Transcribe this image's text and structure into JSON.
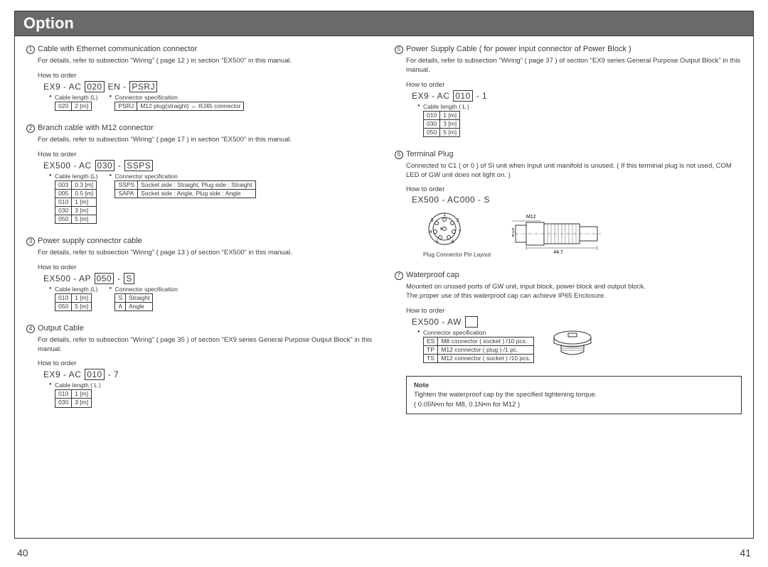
{
  "title": "Option",
  "page_left": "40",
  "page_right": "41",
  "left": {
    "s1": {
      "num": "1",
      "title": "Cable with Ethernet communication connector",
      "body": "For details, refer to subsection \"Wiring\" ( page 12 ) in section \"EX500\" in this manual.",
      "howto": "How to order",
      "pn_prefix": "EX9 - AC",
      "pn_box1": "020",
      "pn_mid": "EN -",
      "pn_box2": "PSRJ",
      "len_label": "Cable length (L)",
      "len_rows": [
        [
          "020",
          "2 [m]"
        ]
      ],
      "conn_label": "Connector specification",
      "conn_rows": [
        [
          "PSRJ",
          "M12 plug(straight) ↔ RJ45 connector"
        ]
      ]
    },
    "s2": {
      "num": "2",
      "title": "Branch cable with M12 connector",
      "body": "For details, refer to subsection \"Wiring\" ( page 17 ) in section \"EX500\" in this manual.",
      "howto": "How to order",
      "pn_prefix": "EX500 - AC",
      "pn_box1": "030",
      "pn_mid": "-",
      "pn_box2": "SSPS",
      "len_label": "Cable length (L)",
      "len_rows": [
        [
          "003",
          "0.3 [m]"
        ],
        [
          "005",
          "0.5 [m]"
        ],
        [
          "010",
          "1 [m]"
        ],
        [
          "030",
          "3 [m]"
        ],
        [
          "050",
          "5 [m]"
        ]
      ],
      "conn_label": "Connector specification",
      "conn_rows": [
        [
          "SSPS",
          "Socket side : Straight, Plug side : Straight"
        ],
        [
          "SAPA",
          "Socket side : Angle, Plug side : Angle"
        ]
      ]
    },
    "s3": {
      "num": "3",
      "title": "Power supply connector cable",
      "body": "For details, refer to subsection \"Wiring\" ( page 13 ) of section \"EX500\" in this manual.",
      "howto": "How to order",
      "pn_prefix": "EX500 - AP",
      "pn_box1": "050",
      "pn_mid": "-",
      "pn_box2": "S",
      "len_label": "Cable length (L)",
      "len_rows": [
        [
          "010",
          "1 [m]"
        ],
        [
          "050",
          "5 [m]"
        ]
      ],
      "conn_label": "Connector specification",
      "conn_rows": [
        [
          "S",
          "Straight"
        ],
        [
          "A",
          "Angle"
        ]
      ]
    },
    "s4": {
      "num": "4",
      "title": "Output Cable",
      "body": "For details, refer to subsection \"Wiring\" ( page 35 ) of section \"EX9 series General Purpose Output Block\" in this manual.",
      "howto": "How to order",
      "pn_prefix": "EX9 - AC",
      "pn_box1": "010",
      "pn_suffix": "- 7",
      "len_label": "Cable length ( L )",
      "len_rows": [
        [
          "010",
          "1 [m]"
        ],
        [
          "030",
          "3 [m]"
        ]
      ]
    }
  },
  "right": {
    "s5": {
      "num": "5",
      "title": "Power Supply Cable ( for power input connector of Power Block )",
      "body": "For details, refer to subsection \"Wiring\" ( page 37 ) of section \"EX9 series General Purpose Output Block\" in this manual.",
      "howto": "How to order",
      "pn_prefix": "EX9 - AC",
      "pn_box1": "010",
      "pn_suffix": "- 1",
      "len_label": "Cable length ( L )",
      "len_rows": [
        [
          "010",
          "1 [m]"
        ],
        [
          "030",
          "3 [m]"
        ],
        [
          "050",
          "5 [m]"
        ]
      ]
    },
    "s6": {
      "num": "6",
      "title": "Terminal Plug",
      "body": "Connected to C1 ( or 0 ) of SI unit when Input unit manifold is unused. ( If this terminal plug is not used, COM LED of GW unit does not light on. )",
      "howto": "How to order",
      "pn": "EX500 - AC000 - S",
      "pin_label": "Plug Connector Pin Layout",
      "dim_m12": "M12",
      "dim_phi": "Φ16",
      "dim_len": "44.7"
    },
    "s7": {
      "num": "7",
      "title": "Waterproof cap",
      "body1": "Mounted on unused ports of GW unit, input block, power block and output block.",
      "body2": "The proper use of this waterproof cap can achieve IP65 Enclosure.",
      "howto": "How to order",
      "pn_prefix": "EX500 - AW",
      "conn_label": "Connector specification",
      "conn_rows": [
        [
          "ES",
          "M8 connector ( socket ) /10 pcs."
        ],
        [
          "TP",
          "M12 connector ( plug ) /1 pc."
        ],
        [
          "TS",
          "M12 connector ( socket ) /10 pcs."
        ]
      ]
    },
    "note": {
      "title": "Note",
      "line1": "Tighten the waterproof cap by the specified tightening torque.",
      "line2": "( 0.05N•m for M8, 0.1N•m for M12 )"
    }
  }
}
